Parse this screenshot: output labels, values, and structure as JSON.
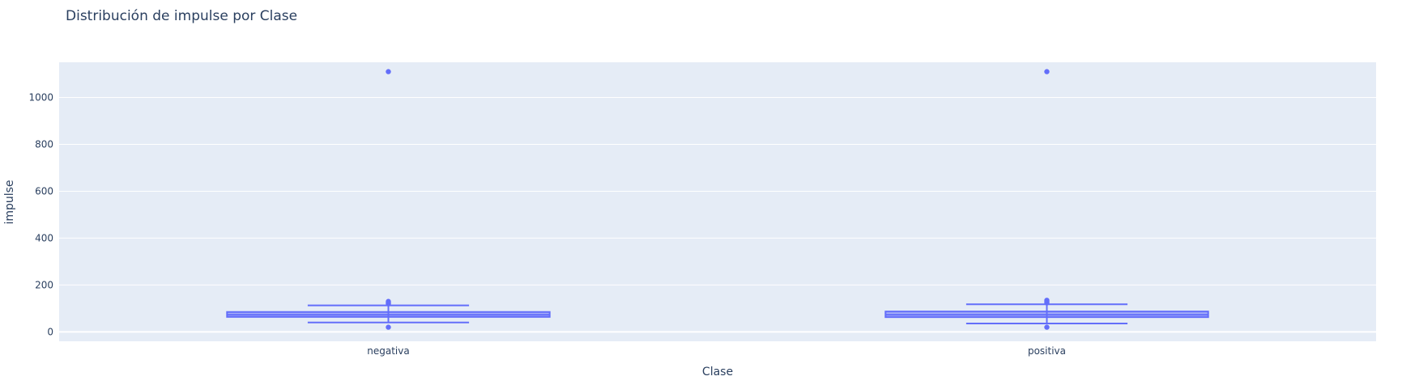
{
  "chart_data": {
    "type": "box",
    "title": "Distribución de impulse por Clase",
    "xlabel": "Clase",
    "ylabel": "impulse",
    "categories": [
      "negativa",
      "positiva"
    ],
    "ylim": [
      -40,
      1150
    ],
    "yticks": [
      0,
      200,
      400,
      600,
      800,
      1000
    ],
    "grid": true,
    "colors": {
      "box": "#636efa",
      "plot_bg": "#e5ecf6",
      "grid": "#ffffff",
      "text": "#2a3f5f"
    },
    "boxes": [
      {
        "category": "negativa",
        "lower_whisker": 40,
        "q1": 64,
        "median": 73,
        "q3": 85,
        "upper_whisker": 113,
        "outliers": [
          20,
          120,
          125,
          130,
          1110
        ]
      },
      {
        "category": "positiva",
        "lower_whisker": 36,
        "q1": 63,
        "median": 73,
        "q3": 87,
        "upper_whisker": 118,
        "outliers": [
          20,
          124,
          130,
          135,
          1110
        ]
      }
    ]
  }
}
